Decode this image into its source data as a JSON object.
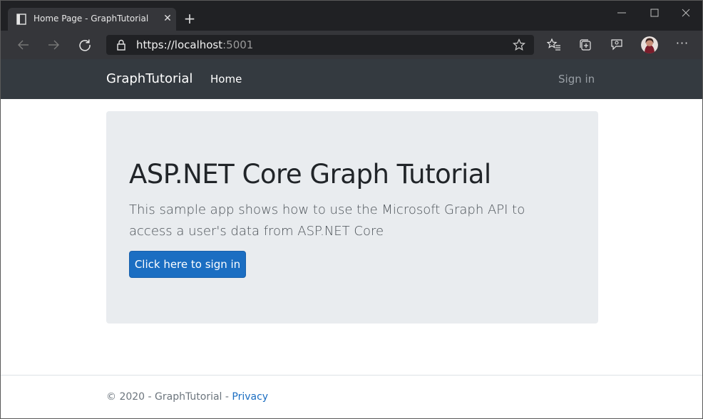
{
  "browser": {
    "tab": {
      "title": "Home Page - GraphTutorial",
      "close_glyph": "✕"
    },
    "new_tab_glyph": "+",
    "address": {
      "scheme": "https://",
      "host": "localhost",
      "port": ":5001"
    },
    "more_glyph": "···",
    "icons": [
      "page-icon",
      "back-icon",
      "forward-icon",
      "refresh-icon",
      "lock-icon",
      "star-icon",
      "favorites-icon",
      "collections-icon",
      "feedback-icon",
      "minimize-icon",
      "maximize-icon",
      "close-icon"
    ]
  },
  "navbar": {
    "brand": "GraphTutorial",
    "items": [
      {
        "label": "Home"
      }
    ],
    "signin": "Sign in",
    "background": "#343a40"
  },
  "jumbotron": {
    "title": "ASP.NET Core Graph Tutorial",
    "lead": "This sample app shows how to use the Microsoft Graph API to access a user's data from ASP.NET Core",
    "button": "Click here to sign in",
    "button_color": "#1b6ec2"
  },
  "footer": {
    "text": "© 2020 - GraphTutorial - ",
    "link": "Privacy"
  }
}
